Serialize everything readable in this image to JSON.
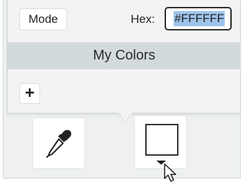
{
  "color_picker": {
    "mode_label": "Mode",
    "hex_label": "Hex:",
    "hex_value": "#FFFFFF",
    "my_colors_label": "My Colors",
    "add_label": "+"
  },
  "tools": {
    "eyedropper_icon": "eyedropper-icon",
    "current_color": "#FFFFFF",
    "dropdown_icon": "chevron-down-icon"
  },
  "colors": {
    "selection_highlight": "#9FC5EC",
    "header_bg": "#D3DADD",
    "popover_bg": "#F2F3F3"
  }
}
